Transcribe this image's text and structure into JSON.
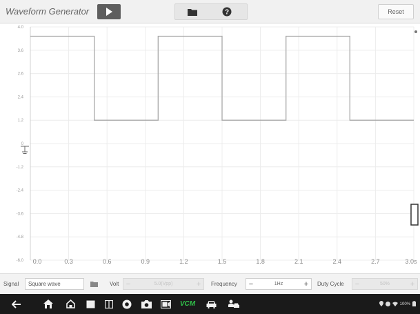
{
  "toolbar": {
    "title": "Waveform Generator",
    "play_icon": "play-icon",
    "folder_icon": "folder-icon",
    "help_icon": "help-icon",
    "reset_label": "Reset"
  },
  "chart_data": {
    "type": "line",
    "title": "",
    "xlabel": "",
    "ylabel": "",
    "x_ticks": [
      "0.0",
      "0.3",
      "0.6",
      "0.9",
      "1.2",
      "1.5",
      "1.8",
      "2.1",
      "2.4",
      "2.7",
      "3.0s"
    ],
    "y_ticks": [
      "4.0",
      "3.6",
      "2.6",
      "2.4",
      "1.2",
      "0",
      "-1.2",
      "-2.4",
      "-3.6",
      "-4.8",
      "-6.0"
    ],
    "xlim": [
      0,
      3.0
    ],
    "ylim": [
      -6.0,
      4.0
    ],
    "grid": true,
    "series": [
      {
        "x": [
          0.0,
          0.5,
          0.5,
          1.0,
          1.0,
          1.5,
          1.5,
          2.0,
          2.0,
          2.5,
          2.5,
          3.0
        ],
        "y": [
          3.6,
          3.6,
          0,
          0,
          3.6,
          3.6,
          0,
          0,
          3.6,
          3.6,
          0,
          0
        ],
        "color": "#a8a8a8"
      }
    ]
  },
  "controls": {
    "signal_label": "Signal",
    "signal_value": "Square wave",
    "signal_folder_icon": "folder-icon",
    "volt_label": "Volt",
    "volt_value": "5.0(Vpp)",
    "frequency_label": "Frequency",
    "frequency_value": "1Hz",
    "duty_label": "Duty Cycle",
    "duty_value": "50%",
    "minus": "−",
    "plus": "+"
  },
  "navbar": {
    "vcm_label": "VCM",
    "status_text": "100%"
  },
  "colors": {
    "toolbar_bg": "#f1f1f1",
    "play_bg": "#5e5e5e",
    "wave": "#a8a8a8",
    "navbar_bg": "#1a1a1a",
    "vcm_green": "#31c34a"
  }
}
